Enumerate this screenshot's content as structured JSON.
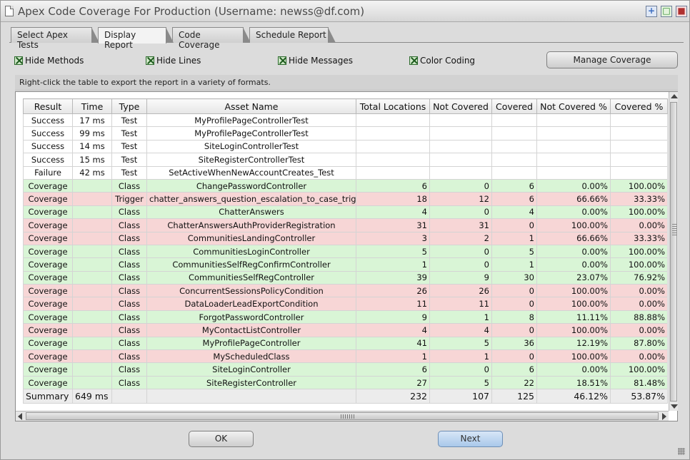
{
  "window": {
    "title": "Apex Code Coverage For Production (Username: newss@df.com)"
  },
  "tabs": [
    {
      "label": "Select Apex Tests",
      "active": false
    },
    {
      "label": "Display Report",
      "active": true
    },
    {
      "label": "Code Coverage",
      "active": false
    },
    {
      "label": "Schedule Report",
      "active": false
    }
  ],
  "options": {
    "hide_methods": {
      "label": "Hide Methods",
      "checked": true
    },
    "hide_lines": {
      "label": "Hide Lines",
      "checked": true
    },
    "hide_messages": {
      "label": "Hide Messages",
      "checked": true
    },
    "color_coding": {
      "label": "Color Coding",
      "checked": true
    },
    "manage_coverage_label": "Manage Coverage"
  },
  "hint": "Right-click the table to export the report in a variety of formats.",
  "table": {
    "columns": [
      "Result",
      "Time",
      "Type",
      "Asset Name",
      "Total Locations",
      "Not Covered",
      "Covered",
      "Not Covered %",
      "Covered %"
    ],
    "rows": [
      {
        "status": "white",
        "cells": [
          "Success",
          "17 ms",
          "Test",
          "MyProfilePageControllerTest",
          "",
          "",
          "",
          "",
          ""
        ]
      },
      {
        "status": "white",
        "cells": [
          "Success",
          "99 ms",
          "Test",
          "MyProfilePageControllerTest",
          "",
          "",
          "",
          "",
          ""
        ]
      },
      {
        "status": "white",
        "cells": [
          "Success",
          "14 ms",
          "Test",
          "SiteLoginControllerTest",
          "",
          "",
          "",
          "",
          ""
        ]
      },
      {
        "status": "white",
        "cells": [
          "Success",
          "15 ms",
          "Test",
          "SiteRegisterControllerTest",
          "",
          "",
          "",
          "",
          ""
        ]
      },
      {
        "status": "white",
        "cells": [
          "Failure",
          "42 ms",
          "Test",
          "SetActiveWhenNewAccountCreates_Test",
          "",
          "",
          "",
          "",
          ""
        ]
      },
      {
        "status": "green",
        "cells": [
          "Coverage",
          "",
          "Class",
          "ChangePasswordController",
          "6",
          "0",
          "6",
          "0.00%",
          "100.00%"
        ]
      },
      {
        "status": "red",
        "cells": [
          "Coverage",
          "",
          "Trigger",
          "chatter_answers_question_escalation_to_case_trigger",
          "18",
          "12",
          "6",
          "66.66%",
          "33.33%"
        ]
      },
      {
        "status": "green",
        "cells": [
          "Coverage",
          "",
          "Class",
          "ChatterAnswers",
          "4",
          "0",
          "4",
          "0.00%",
          "100.00%"
        ]
      },
      {
        "status": "red",
        "cells": [
          "Coverage",
          "",
          "Class",
          "ChatterAnswersAuthProviderRegistration",
          "31",
          "31",
          "0",
          "100.00%",
          "0.00%"
        ]
      },
      {
        "status": "red",
        "cells": [
          "Coverage",
          "",
          "Class",
          "CommunitiesLandingController",
          "3",
          "2",
          "1",
          "66.66%",
          "33.33%"
        ]
      },
      {
        "status": "green",
        "cells": [
          "Coverage",
          "",
          "Class",
          "CommunitiesLoginController",
          "5",
          "0",
          "5",
          "0.00%",
          "100.00%"
        ]
      },
      {
        "status": "green",
        "cells": [
          "Coverage",
          "",
          "Class",
          "CommunitiesSelfRegConfirmController",
          "1",
          "0",
          "1",
          "0.00%",
          "100.00%"
        ]
      },
      {
        "status": "green",
        "cells": [
          "Coverage",
          "",
          "Class",
          "CommunitiesSelfRegController",
          "39",
          "9",
          "30",
          "23.07%",
          "76.92%"
        ]
      },
      {
        "status": "red",
        "cells": [
          "Coverage",
          "",
          "Class",
          "ConcurrentSessionsPolicyCondition",
          "26",
          "26",
          "0",
          "100.00%",
          "0.00%"
        ]
      },
      {
        "status": "red",
        "cells": [
          "Coverage",
          "",
          "Class",
          "DataLoaderLeadExportCondition",
          "11",
          "11",
          "0",
          "100.00%",
          "0.00%"
        ]
      },
      {
        "status": "green",
        "cells": [
          "Coverage",
          "",
          "Class",
          "ForgotPasswordController",
          "9",
          "1",
          "8",
          "11.11%",
          "88.88%"
        ]
      },
      {
        "status": "red",
        "cells": [
          "Coverage",
          "",
          "Class",
          "MyContactListController",
          "4",
          "4",
          "0",
          "100.00%",
          "0.00%"
        ]
      },
      {
        "status": "green",
        "cells": [
          "Coverage",
          "",
          "Class",
          "MyProfilePageController",
          "41",
          "5",
          "36",
          "12.19%",
          "87.80%"
        ]
      },
      {
        "status": "red",
        "cells": [
          "Coverage",
          "",
          "Class",
          "MyScheduledClass",
          "1",
          "1",
          "0",
          "100.00%",
          "0.00%"
        ]
      },
      {
        "status": "green",
        "cells": [
          "Coverage",
          "",
          "Class",
          "SiteLoginController",
          "6",
          "0",
          "6",
          "0.00%",
          "100.00%"
        ]
      },
      {
        "status": "green",
        "cells": [
          "Coverage",
          "",
          "Class",
          "SiteRegisterController",
          "27",
          "5",
          "22",
          "18.51%",
          "81.48%"
        ]
      }
    ],
    "summary": [
      "Summary",
      "649 ms",
      "",
      "",
      "232",
      "107",
      "125",
      "46.12%",
      "53.87%"
    ]
  },
  "buttons": {
    "ok": "OK",
    "next": "Next"
  },
  "colors": {
    "covered_row": "#d9f5d6",
    "uncovered_row": "#f7d6d6",
    "next_button": "#a9c8ea"
  }
}
